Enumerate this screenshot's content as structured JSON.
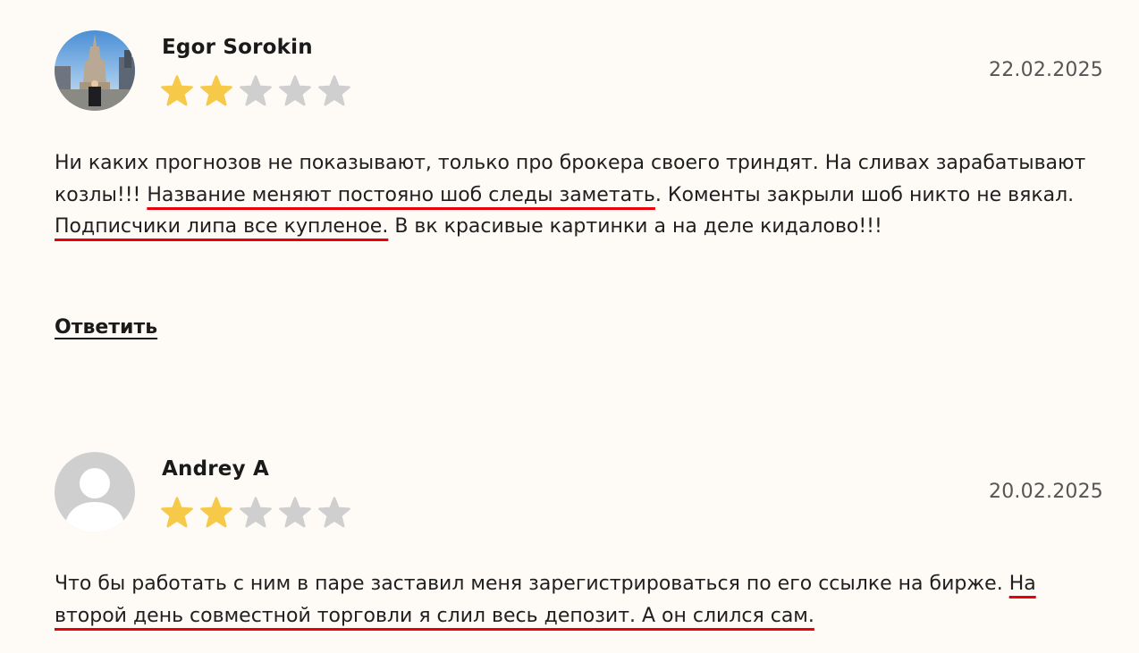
{
  "reviews": [
    {
      "author": "Egor Sorokin",
      "rating": 2,
      "max_rating": 5,
      "date": "22.02.2025",
      "avatar": "photo-avatar",
      "text_segments": [
        {
          "text": "Ни каких прогнозов не показывают, только про брокера своего триндят. На сливах зарабатывают козлы!!! ",
          "highlight": false
        },
        {
          "text": "Название меняют постояно шоб следы заметать",
          "highlight": true
        },
        {
          "text": ". Коменты закрыли шоб никто не вякал. ",
          "highlight": false
        },
        {
          "text": "Подписчики липа все купленое.",
          "highlight": true
        },
        {
          "text": " В вк красивые картинки а на деле кидалово!!!",
          "highlight": false
        }
      ],
      "reply_label": "Ответить"
    },
    {
      "author": "Andrey A",
      "rating": 2,
      "max_rating": 5,
      "date": "20.02.2025",
      "avatar": "default-user-icon",
      "text_segments": [
        {
          "text": "Что бы работать с ним в паре заставил меня зарегистрироваться по его ссылке на бирже. ",
          "highlight": false
        },
        {
          "text": "На второй день совместной торговли я слил весь депозит. А он слился сам.",
          "highlight": true
        }
      ]
    }
  ],
  "colors": {
    "background": "#fefbf7",
    "star_filled": "#f7c948",
    "star_empty": "#cfcfcf",
    "highlight_underline": "#e8000b"
  }
}
